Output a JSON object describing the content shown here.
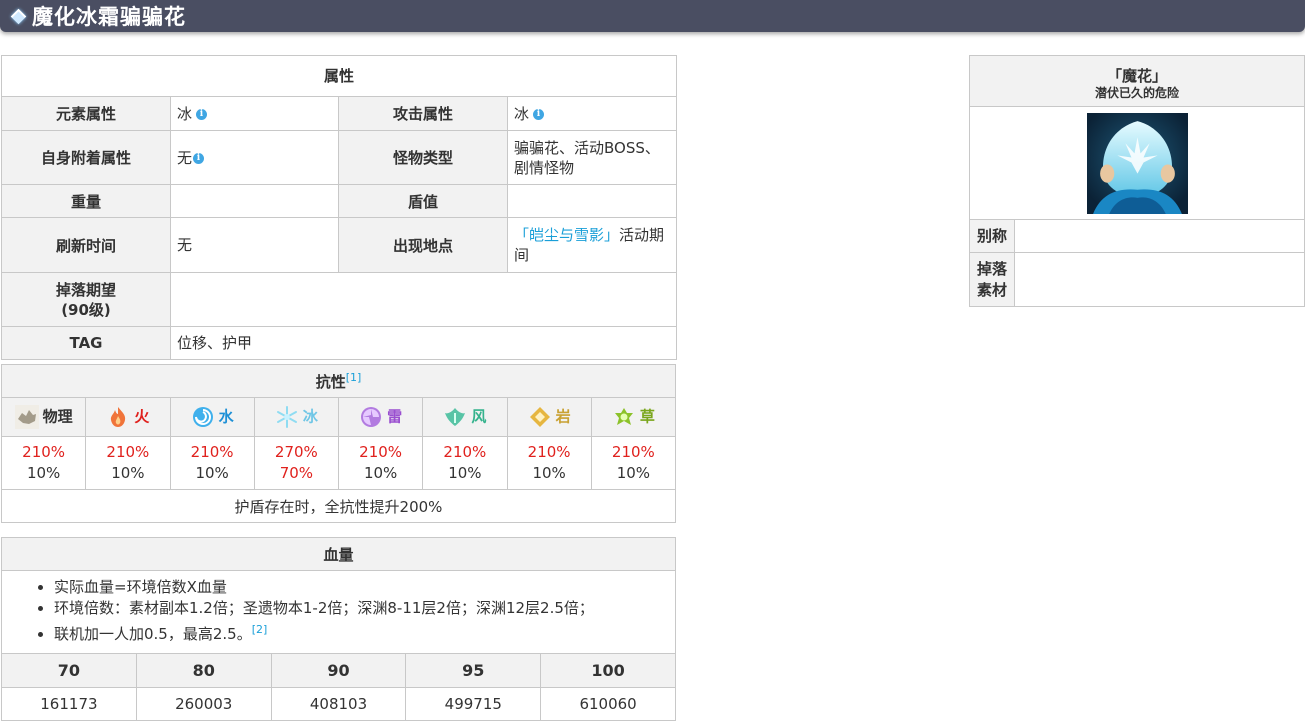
{
  "page": {
    "title": "魔化冰霜骗骗花"
  },
  "attributes": {
    "caption": "属性",
    "rows": [
      {
        "l1": "元素属性",
        "v1": "冰",
        "l2": "攻击属性",
        "v2": "冰"
      },
      {
        "l1": "自身附着属性",
        "v1": "无",
        "l2": "怪物类型",
        "v2": "骗骗花、活动BOSS、剧情怪物"
      },
      {
        "l1": "重量",
        "v1": "",
        "l2": "盾值",
        "v2": ""
      },
      {
        "l1": "刷新时间",
        "v1": "无",
        "l2": "出现地点",
        "v2_link": "「皑尘与雪影」",
        "v2_rest": "活动期间"
      },
      {
        "l1": "掉落期望(90级)",
        "v1": ""
      },
      {
        "l1": "TAG",
        "v1": "位移、护甲"
      }
    ],
    "drop_label_line1": "掉落期望",
    "drop_label_line2": "(90级)",
    "info_icon": "i"
  },
  "resistance": {
    "title": "抗性",
    "footnote": "[1]",
    "elements": [
      {
        "name": "物理",
        "icon": "physical-icon",
        "color": "#333333",
        "top": "210%",
        "bottom": "10%"
      },
      {
        "name": "火",
        "icon": "pyro-icon",
        "color": "#e0211d",
        "top": "210%",
        "bottom": "10%"
      },
      {
        "name": "水",
        "icon": "hydro-icon",
        "color": "#1e90d6",
        "top": "210%",
        "bottom": "10%"
      },
      {
        "name": "冰",
        "icon": "cryo-icon",
        "color": "#6fc6e6",
        "top": "270%",
        "bottom": "70%"
      },
      {
        "name": "雷",
        "icon": "electro-icon",
        "color": "#9a4fd0",
        "top": "210%",
        "bottom": "10%"
      },
      {
        "name": "风",
        "icon": "anemo-icon",
        "color": "#35b38d",
        "top": "210%",
        "bottom": "10%"
      },
      {
        "name": "岩",
        "icon": "geo-icon",
        "color": "#c9a233",
        "top": "210%",
        "bottom": "10%"
      },
      {
        "name": "草",
        "icon": "dendro-icon",
        "color": "#7aa61c",
        "top": "210%",
        "bottom": "10%"
      }
    ],
    "note": "护盾存在时，全抗性提升200%"
  },
  "hp": {
    "title": "血量",
    "notes": [
      "实际血量=环境倍数X血量",
      "环境倍数：素材副本1.2倍；圣遗物本1-2倍；深渊8-11层2倍；深渊12层2.5倍；",
      "联机加一人加0.5，最高2.5。"
    ],
    "note_footnote": "[2]",
    "levels": [
      "70",
      "80",
      "90",
      "95",
      "100"
    ],
    "values": [
      "161173",
      "260003",
      "408103",
      "499715",
      "610060"
    ]
  },
  "infobox": {
    "name": "「魔花」",
    "subtitle": "潜伏已久的危险",
    "alias_label": "别称",
    "alias_value": "",
    "drops_label_line1": "掉落",
    "drops_label_line2": "素材",
    "drops_value": ""
  },
  "colors": {
    "header_bg": "#4a4e62",
    "link": "#1a9fd8",
    "resist_red": "#e0211d"
  }
}
